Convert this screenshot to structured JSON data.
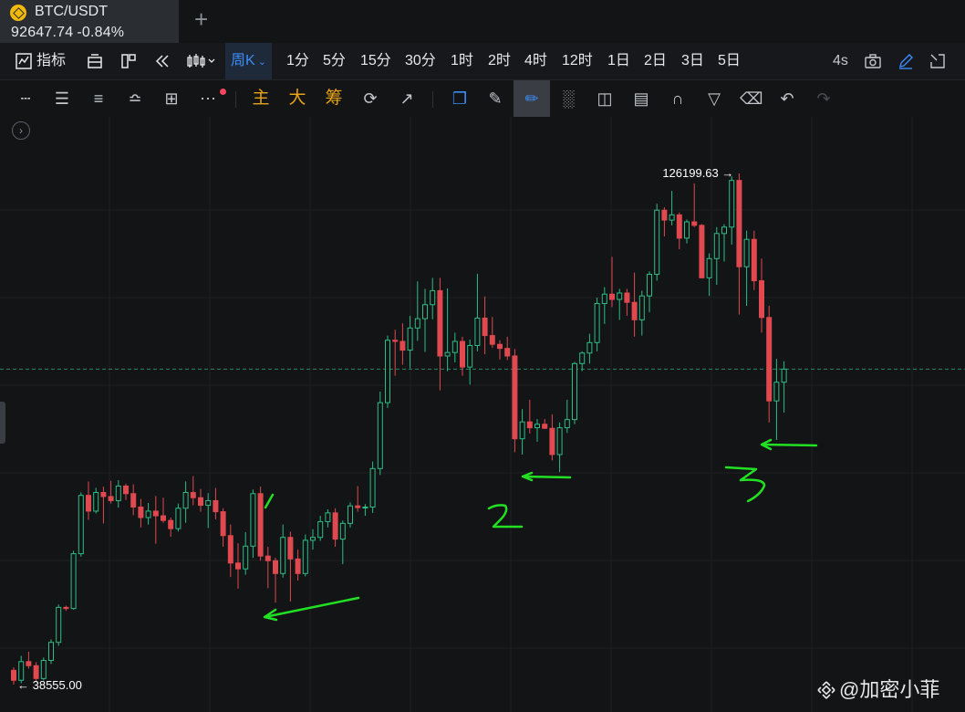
{
  "tab": {
    "symbol": "BTC/USDT",
    "price": "92647.74",
    "change": "-0.84%"
  },
  "toolbar1": {
    "indicators_label": "指标",
    "period_label": "周K",
    "intervals": [
      "1分",
      "5分",
      "15分",
      "30分",
      "1时",
      "2时",
      "4时",
      "12时",
      "1日",
      "2日",
      "3日",
      "5日"
    ],
    "refresh": "4s"
  },
  "toolbar2": {
    "main_label": "主",
    "big_label": "大",
    "chips_label": "筹"
  },
  "chart_data": {
    "type": "candlestick",
    "title": "",
    "xlabel": "",
    "ylabel": "",
    "ylim": [
      30000,
      135000
    ],
    "max_label": "126199.63",
    "min_label": "38555.00",
    "current_price": 92647.74,
    "colors": {
      "up": "#2ebd85",
      "down": "#e0494f",
      "current_line": "#2ebd85"
    },
    "candles": [
      [
        41000,
        41500,
        38555,
        39300
      ],
      [
        39300,
        43500,
        38800,
        42500
      ],
      [
        42500,
        44200,
        41300,
        41800
      ],
      [
        41800,
        42400,
        39000,
        39600
      ],
      [
        39600,
        43200,
        39300,
        42700
      ],
      [
        42700,
        46300,
        42100,
        45800
      ],
      [
        45800,
        52300,
        45200,
        51800
      ],
      [
        51800,
        52100,
        51200,
        51600
      ],
      [
        51600,
        61500,
        51400,
        61000
      ],
      [
        61000,
        71500,
        60500,
        71000
      ],
      [
        71000,
        73400,
        66800,
        68300
      ],
      [
        68300,
        72300,
        67900,
        71500
      ],
      [
        71500,
        72500,
        66200,
        70800
      ],
      [
        70800,
        73500,
        69600,
        70100
      ],
      [
        70100,
        73600,
        68900,
        72600
      ],
      [
        72600,
        73000,
        70200,
        71300
      ],
      [
        71300,
        72900,
        67600,
        69000
      ],
      [
        69000,
        70400,
        65500,
        67200
      ],
      [
        67200,
        69700,
        66000,
        68300
      ],
      [
        68300,
        70900,
        62700,
        67500
      ],
      [
        67500,
        70600,
        66300,
        66700
      ],
      [
        66700,
        67200,
        63900,
        65300
      ],
      [
        65300,
        69600,
        64800,
        68800
      ],
      [
        68800,
        73400,
        66300,
        71500
      ],
      [
        71500,
        74300,
        69300,
        70600
      ],
      [
        70600,
        72100,
        68200,
        69300
      ],
      [
        69300,
        71400,
        65400,
        70100
      ],
      [
        70100,
        72300,
        66900,
        68200
      ],
      [
        68200,
        68800,
        62200,
        64100
      ],
      [
        64100,
        66000,
        57000,
        59400
      ],
      [
        59400,
        62800,
        55000,
        58400
      ],
      [
        58400,
        64700,
        57400,
        62300
      ],
      [
        62300,
        72000,
        60300,
        71300
      ],
      [
        71300,
        72500,
        59800,
        60600
      ],
      [
        60600,
        62200,
        55100,
        59800
      ],
      [
        59800,
        60300,
        52600,
        57600
      ],
      [
        57600,
        66000,
        56900,
        63800
      ],
      [
        63800,
        64800,
        52800,
        60100
      ],
      [
        60100,
        61700,
        56400,
        57600
      ],
      [
        57600,
        64300,
        57100,
        63300
      ],
      [
        63300,
        65200,
        61700,
        63800
      ],
      [
        63800,
        67500,
        63200,
        66500
      ],
      [
        66500,
        68600,
        65500,
        68000
      ],
      [
        68000,
        68800,
        62200,
        63500
      ],
      [
        63500,
        66700,
        59200,
        66200
      ],
      [
        66200,
        69800,
        65500,
        69200
      ],
      [
        69200,
        72600,
        68200,
        68900
      ],
      [
        68900,
        69500,
        67500,
        69000
      ],
      [
        69000,
        76800,
        68000,
        75600
      ],
      [
        75600,
        88800,
        74500,
        86900
      ],
      [
        86900,
        98400,
        86000,
        97600
      ],
      [
        97600,
        99400,
        91500,
        97400
      ],
      [
        97400,
        100500,
        93400,
        95900
      ],
      [
        95900,
        101800,
        92800,
        99700
      ],
      [
        99700,
        107700,
        97500,
        101300
      ],
      [
        101300,
        106400,
        95600,
        103700
      ],
      [
        103700,
        108300,
        101200,
        106100
      ],
      [
        106100,
        108300,
        89000,
        94900
      ],
      [
        94900,
        106500,
        92300,
        95500
      ],
      [
        95500,
        98900,
        93800,
        97400
      ],
      [
        97400,
        98200,
        91500,
        93000
      ],
      [
        93000,
        97700,
        90000,
        96700
      ],
      [
        96700,
        109000,
        95700,
        101400
      ],
      [
        101400,
        105100,
        95200,
        98400
      ],
      [
        98400,
        101600,
        96300,
        96900
      ],
      [
        96900,
        97600,
        94300,
        96200
      ],
      [
        96200,
        98200,
        94200,
        94900
      ],
      [
        94900,
        96100,
        78400,
        80700
      ],
      [
        80700,
        85800,
        78000,
        83600
      ],
      [
        83600,
        87400,
        81600,
        82600
      ],
      [
        82600,
        84100,
        80200,
        83200
      ],
      [
        83200,
        84100,
        82400,
        82500
      ],
      [
        82500,
        84900,
        77000,
        78000
      ],
      [
        78000,
        83500,
        75000,
        82600
      ],
      [
        82600,
        87400,
        81700,
        84000
      ],
      [
        84000,
        93900,
        83200,
        93600
      ],
      [
        93600,
        95700,
        92300,
        95400
      ],
      [
        95400,
        98700,
        93600,
        97200
      ],
      [
        97200,
        104900,
        95700,
        103900
      ],
      [
        103900,
        106700,
        100400,
        105500
      ],
      [
        105500,
        111900,
        103300,
        104600
      ],
      [
        104600,
        106400,
        101100,
        105700
      ],
      [
        105700,
        106400,
        101800,
        104100
      ],
      [
        104100,
        109200,
        98200,
        101100
      ],
      [
        101100,
        106100,
        98400,
        105200
      ],
      [
        105200,
        109400,
        102400,
        108900
      ],
      [
        108900,
        121000,
        107800,
        119900
      ],
      [
        119900,
        120400,
        115400,
        118200
      ],
      [
        118200,
        123200,
        117300,
        119100
      ],
      [
        119100,
        119500,
        113200,
        115100
      ],
      [
        115100,
        118300,
        114200,
        117900
      ],
      [
        117900,
        124500,
        117000,
        117300
      ],
      [
        117300,
        117500,
        109000,
        108300
      ],
      [
        108300,
        112500,
        105200,
        111600
      ],
      [
        111600,
        117000,
        107100,
        115900
      ],
      [
        115900,
        117500,
        111100,
        117000
      ],
      [
        117000,
        125700,
        114000,
        125000
      ],
      [
        125000,
        126199.63,
        102000,
        110200
      ],
      [
        110200,
        116400,
        103500,
        114900
      ],
      [
        114900,
        116400,
        106200,
        107800
      ],
      [
        107800,
        111600,
        98900,
        101500
      ],
      [
        101500,
        103500,
        83500,
        87200
      ],
      [
        87200,
        94400,
        80500,
        90400
      ],
      [
        90400,
        94000,
        85200,
        92647.74
      ]
    ]
  }
}
